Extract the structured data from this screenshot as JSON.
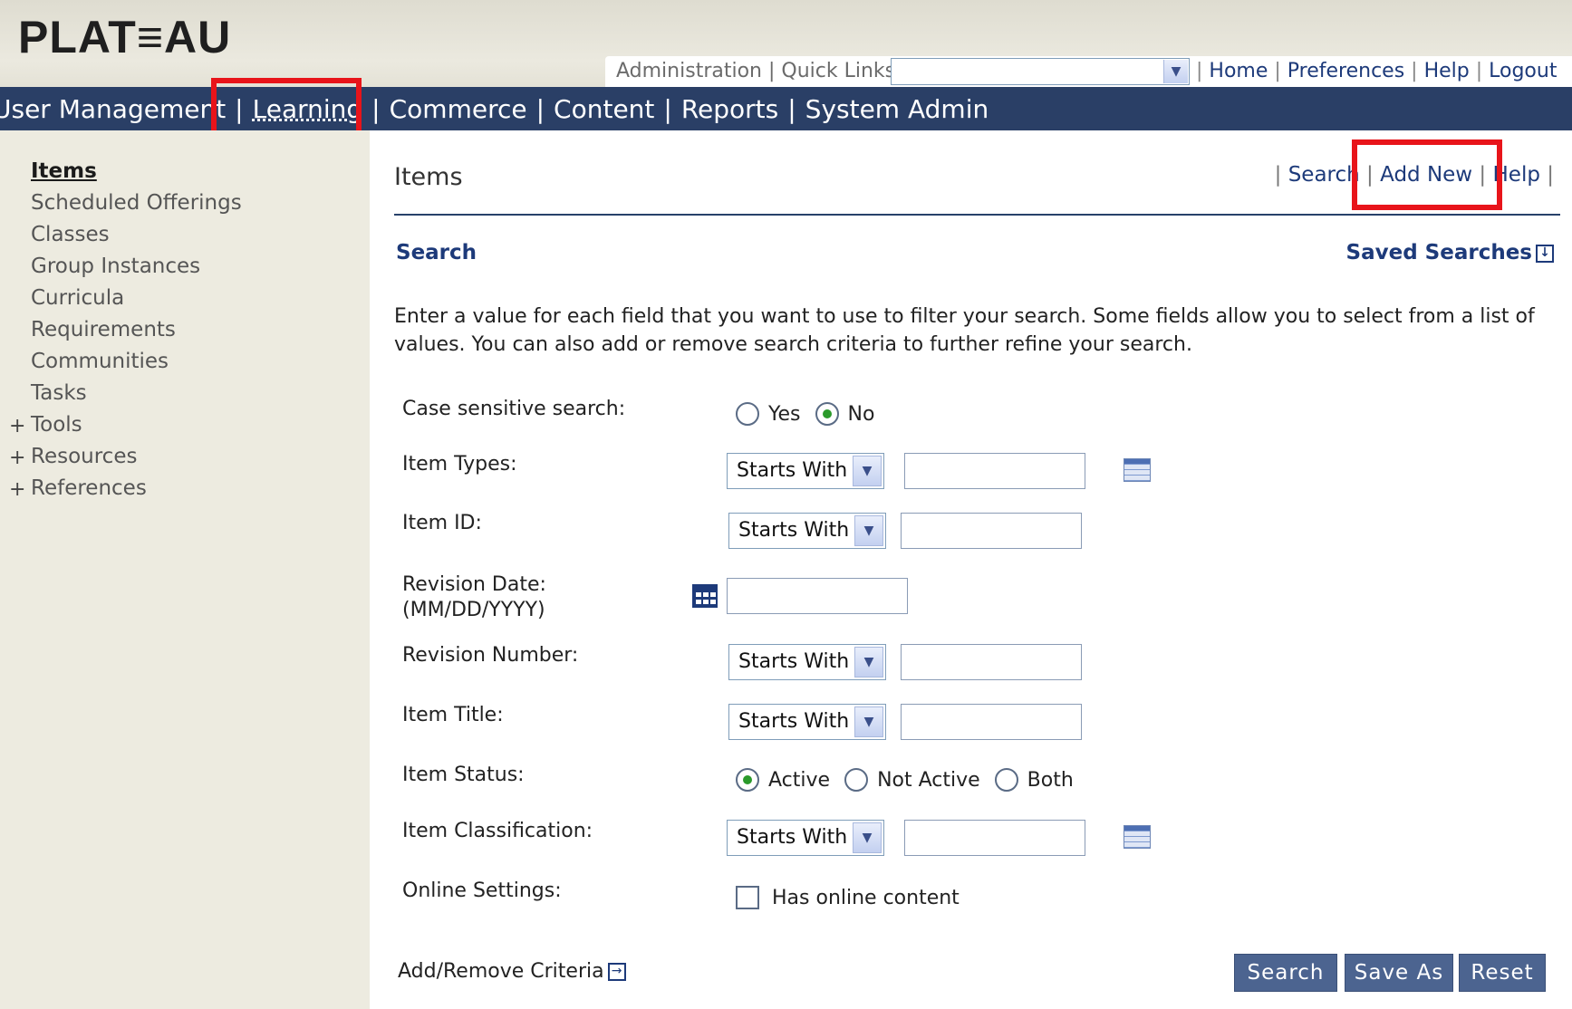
{
  "header": {
    "logo": "PLAT≡AU",
    "admin_label": "Administration | Quick Links:",
    "quick_links_value": "",
    "util_links": [
      "Home",
      "Preferences",
      "Help",
      "Logout"
    ]
  },
  "nav": {
    "items": [
      "User Management",
      "Learning",
      "Commerce",
      "Content",
      "Reports",
      "System Admin"
    ],
    "active": "Learning"
  },
  "sidebar": {
    "items": [
      {
        "label": "Items",
        "current": true
      },
      {
        "label": "Scheduled Offerings"
      },
      {
        "label": "Classes"
      },
      {
        "label": "Group Instances"
      },
      {
        "label": "Curricula"
      },
      {
        "label": "Requirements"
      },
      {
        "label": "Communities"
      },
      {
        "label": "Tasks"
      }
    ],
    "expandable": [
      "Tools",
      "Resources",
      "References"
    ]
  },
  "main": {
    "title": "Items",
    "actions": [
      "Search",
      "Add New",
      "Help"
    ],
    "search_heading": "Search",
    "saved_searches": "Saved Searches",
    "instructions": "Enter a value for each field that you want to use to filter your search. Some fields allow you to select from a list of values. You can also add or remove search criteria to further refine your search.",
    "form": {
      "case_sensitive": {
        "label": "Case sensitive search:",
        "yes": "Yes",
        "no": "No",
        "selected": "No"
      },
      "item_types": {
        "label": "Item Types:",
        "operator": "Starts With",
        "value": ""
      },
      "item_id": {
        "label": "Item ID:",
        "operator": "Starts With",
        "value": ""
      },
      "revision_date": {
        "label": "Revision Date:",
        "format": "(MM/DD/YYYY)",
        "value": ""
      },
      "revision_number": {
        "label": "Revision Number:",
        "operator": "Starts With",
        "value": ""
      },
      "item_title": {
        "label": "Item Title:",
        "operator": "Starts With",
        "value": ""
      },
      "item_status": {
        "label": "Item Status:",
        "active": "Active",
        "not_active": "Not Active",
        "both": "Both",
        "selected": "Active"
      },
      "item_classification": {
        "label": "Item Classification:",
        "operator": "Starts With",
        "value": ""
      },
      "online_settings": {
        "label": "Online Settings:",
        "checkbox_label": "Has online content",
        "checked": false
      }
    },
    "add_remove_criteria": "Add/Remove Criteria",
    "buttons": {
      "search": "Search",
      "save_as": "Save As",
      "reset": "Reset"
    }
  },
  "colors": {
    "nav_bg": "#2a3f66",
    "link": "#1d3a7a",
    "highlight": "#e8141a",
    "sidebar_bg": "#edebe0",
    "button_bg": "#4c6490"
  }
}
